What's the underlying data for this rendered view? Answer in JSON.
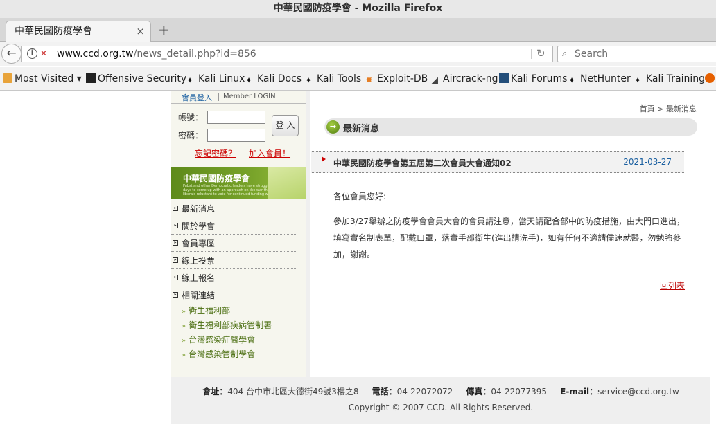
{
  "window": {
    "title": "中華民國防疫學會 - Mozilla Firefox"
  },
  "tab": {
    "label": "中華民國防疫學會",
    "close": "×",
    "new_tab": "+"
  },
  "nav": {
    "url_host": "www.ccd.org.tw",
    "url_path": "/news_detail.php?id=856",
    "search_placeholder": "Search"
  },
  "bookmarks": [
    {
      "label": "Most Visited",
      "icon": "folder-icon"
    },
    {
      "label": "Offensive Security",
      "icon": "offsec-icon"
    },
    {
      "label": "Kali Linux",
      "icon": "kali-icon"
    },
    {
      "label": "Kali Docs",
      "icon": "kali-icon"
    },
    {
      "label": "Kali Tools",
      "icon": "kali-icon"
    },
    {
      "label": "Exploit-DB",
      "icon": "exploit-db-icon"
    },
    {
      "label": "Aircrack-ng",
      "icon": "aircrack-icon"
    },
    {
      "label": "Kali Forums",
      "icon": "forums-icon"
    },
    {
      "label": "NetHunter",
      "icon": "kali-icon"
    },
    {
      "label": "Kali Training",
      "icon": "kali-icon"
    }
  ],
  "login": {
    "title": "會員登入",
    "subtitle": "Member LOGIN",
    "account_label": "帳號：",
    "password_label": "密碼：",
    "submit": "登 入",
    "forgot": "忘記密碼？",
    "join": "加入會員！"
  },
  "banner": {
    "title": "中華民國防疫學會",
    "tagline": "Pabst and other Democratic leaders have struggled in recent days to come up with an approach on the war that will satisfy liberals reluctant to vote for continued funding without"
  },
  "menu": {
    "items": [
      "最新消息",
      "關於學會",
      "會員專區",
      "線上投票",
      "線上報名",
      "相關連結"
    ],
    "sub_items": [
      "衛生福利部",
      "衛生福利部疾病管制署",
      "台灣感染症醫學會",
      "台灣感染管制學會"
    ]
  },
  "main": {
    "breadcrumb": "首頁 > 最新消息",
    "section_title": "最新消息",
    "news_title": "中華民國防疫學會第五屆第二次會員大會通知02",
    "news_date": "2021-03-27",
    "greeting": "各位會員您好:",
    "paragraph": "參加3/27舉辦之防疫學會會員大會的會員請注意，當天請配合部中的防疫措施，由大門口進出，填寫實名制表單，配戴口罩，落實手部衛生(進出請洗手)，如有任何不適請儘速就醫，勿勉強參加，謝謝。",
    "back_link": "回列表"
  },
  "footer": {
    "address_label": "會址：",
    "address": "404 台中市北區大德街49號3樓之8",
    "phone_label": "電話：",
    "phone": "04-22072072",
    "fax_label": "傳真：",
    "fax": "04-22077395",
    "email_label": "E-mail：",
    "email": "service@ccd.org.tw",
    "copyright": "Copyright © 2007 CCD. All Rights Reserved."
  }
}
